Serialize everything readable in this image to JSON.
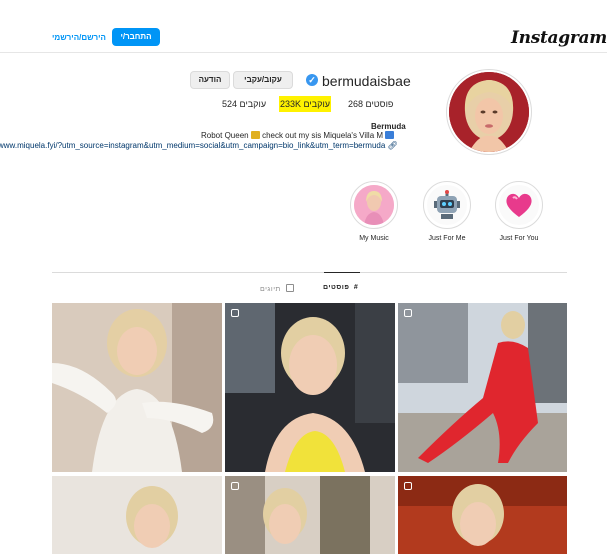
{
  "header": {
    "logo": "Instagram",
    "login_label": "התחבר/י",
    "signup_label": "הירשם/הירשמי"
  },
  "profile": {
    "username": "bermudaisbae",
    "verified": true,
    "follow_label": "עקוב/עקבי",
    "message_label": "הודעה",
    "stats": {
      "posts": "268 פוסטים",
      "followers": "233K עוקבים",
      "following": "524 עוקבים"
    },
    "bio_name": "Bermuda",
    "bio_text_before": "Robot Queen",
    "bio_text_after": "check out my sis Miquela's Villa M",
    "bio_link": "www.miquela.fyi/?utm_source=instagram&utm_medium=social&utm_campaign=bio_link&utm_term=bermuda"
  },
  "highlights": [
    {
      "label": "Just For You",
      "icon": "heart-icon"
    },
    {
      "label": "Just For Me",
      "icon": "robot-icon"
    },
    {
      "label": "My Music",
      "icon": "person-icon"
    }
  ],
  "tabs": {
    "posts_label": "פוסטים",
    "tagged_label": "תיוגים"
  },
  "colors": {
    "accent": "#0095f6",
    "highlight_marker": "#fff200",
    "verified": "#3897f0"
  }
}
